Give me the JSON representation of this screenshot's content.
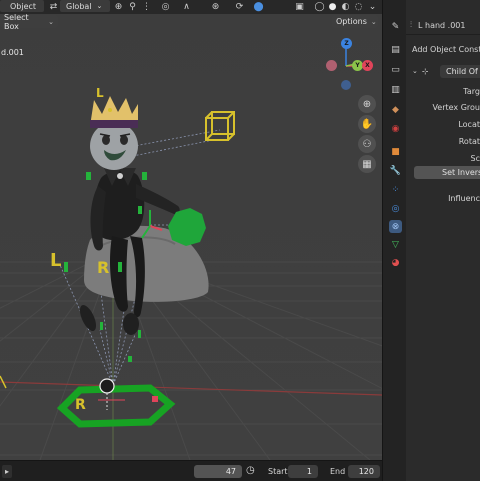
{
  "header": {
    "mode_label": "Object",
    "transform_orientation": "Global"
  },
  "toolbar": {
    "select_box_label": "Select Box",
    "options_label": "Options"
  },
  "viewport": {
    "object_label": "d.001",
    "gizmo": {
      "x": "X",
      "y": "Y",
      "z": "Z"
    },
    "rig_letters": {
      "left": "L",
      "right": "R"
    }
  },
  "properties": {
    "object_name": "L hand .001",
    "add_constraint_label": "Add Object Constra",
    "constraint_type": "Child Of",
    "fields": [
      {
        "label": "Targ"
      },
      {
        "label": "Vertex Grou"
      },
      {
        "label": "Locat"
      },
      {
        "label": "Rotat"
      },
      {
        "label": "Sc"
      }
    ],
    "set_inverse_label": "Set Inverse",
    "influence_label": "Influenc"
  },
  "timeline": {
    "current_frame": "47",
    "start_label": "Start",
    "start_value": "1",
    "end_label": "End",
    "end_value": "120"
  },
  "colors": {
    "x_axis": "#e0445a",
    "y_axis": "#8bc34a",
    "z_axis": "#3b83e0",
    "rig_green": "#24b33b",
    "rig_yellow": "#d7c12c"
  }
}
